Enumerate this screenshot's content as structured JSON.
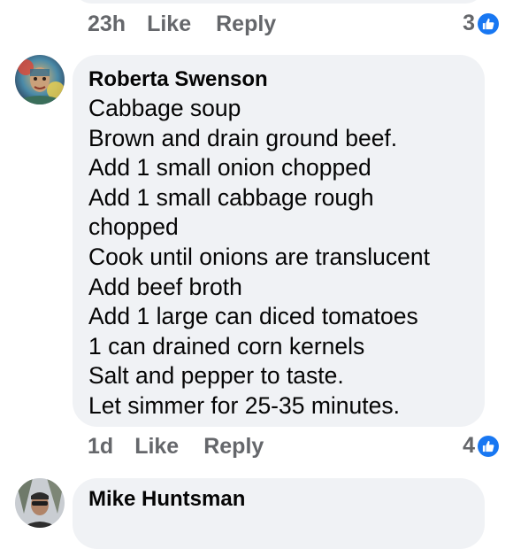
{
  "previous_comment": {
    "time": "23h",
    "like_label": "Like",
    "reply_label": "Reply",
    "reaction_count": "3"
  },
  "comment": {
    "author": "Roberta Swenson",
    "lines": [
      "Cabbage soup",
      "Brown and drain ground beef.",
      "Add 1 small onion chopped",
      "Add 1 small cabbage rough",
      "chopped",
      "Cook until onions are translucent",
      "Add beef broth",
      "Add 1 large can diced tomatoes",
      "1 can drained corn kernels",
      "Salt and pepper to taste.",
      "Let simmer for 25-35 minutes."
    ],
    "time": "1d",
    "like_label": "Like",
    "reply_label": "Reply",
    "reaction_count": "4"
  },
  "next_comment": {
    "author": "Mike Huntsman"
  },
  "icons": {
    "reaction": "like-thumb-icon",
    "avatar_roberta": "avatar",
    "avatar_mike": "avatar"
  },
  "colors": {
    "bubble": "#f0f2f5",
    "meta_text": "#65676b",
    "like_blue": "#1877f2"
  }
}
